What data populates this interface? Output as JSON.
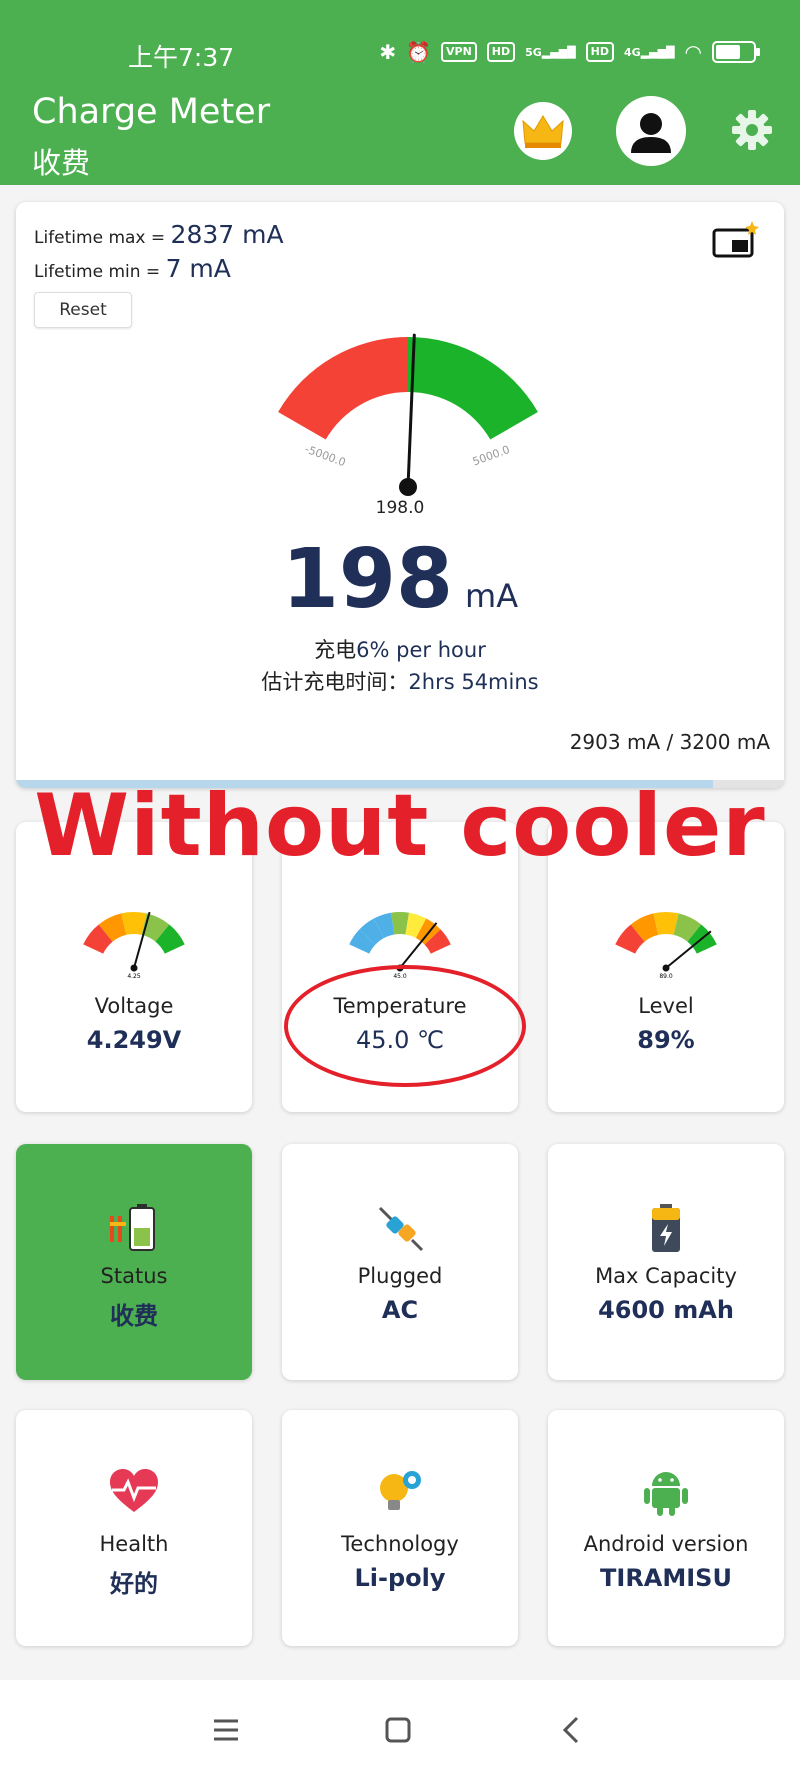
{
  "status_bar": {
    "time": "上午7:37",
    "vpn": "VPN",
    "hd1": "HD",
    "signal1": "5G",
    "hd2": "HD",
    "signal2": "4G"
  },
  "app_bar": {
    "title": "Charge Meter",
    "subtitle": "收费"
  },
  "main_card": {
    "lifetime_max_label": "Lifetime max = ",
    "lifetime_max_value": "2837 mA",
    "lifetime_min_label": "Lifetime min = ",
    "lifetime_min_value": "7 mA",
    "reset_label": "Reset",
    "gauge": {
      "min_label": "-5000.0",
      "max_label": "5000.0",
      "min": -5000,
      "max": 5000,
      "needle_value": 198.0,
      "needle_label": "198.0"
    },
    "current_value": "198",
    "current_unit": "mA",
    "rate_prefix": "充电",
    "rate_value": "6% per hour",
    "eta_prefix": "估计充电时间：",
    "eta_value": "2hrs 54mins",
    "capacity_text": "2903 mA / 3200 mA",
    "capacity_fraction": 0.907
  },
  "overlay": {
    "text": "Without cooler"
  },
  "tiles": {
    "voltage": {
      "label": "Voltage",
      "value": "4.249V",
      "gauge_label": "4.25",
      "level": 0.62
    },
    "temperature": {
      "label": "Temperature",
      "value": "45.0 ℃",
      "gauge_label": "45.0",
      "level": 0.8
    },
    "level": {
      "label": "Level",
      "value": "89%",
      "gauge_label": "89.0",
      "level": 0.89
    },
    "status": {
      "label": "Status",
      "value": "收费"
    },
    "plugged": {
      "label": "Plugged",
      "value": "AC"
    },
    "max_capacity": {
      "label": "Max Capacity",
      "value": "4600 mAh"
    },
    "health": {
      "label": "Health",
      "value": "好的"
    },
    "technology": {
      "label": "Technology",
      "value": "Li-poly"
    },
    "android_version": {
      "label": "Android version",
      "value": "TIRAMISU"
    }
  },
  "colors": {
    "brand_green": "#4caf50",
    "gauge_red": "#f44336",
    "gauge_green": "#1bb32a",
    "value_navy": "#1f2f57",
    "annotation_red": "#e4202a"
  },
  "icons": {
    "crown": "crown-icon",
    "avatar": "person-icon",
    "settings": "gear-icon",
    "pip": "picture-in-picture-icon",
    "status": "battery-charging-icon",
    "plugged": "plug-icon",
    "max_capacity": "battery-icon",
    "health": "heart-pulse-icon",
    "technology": "lightbulb-gear-icon",
    "android": "android-icon"
  }
}
